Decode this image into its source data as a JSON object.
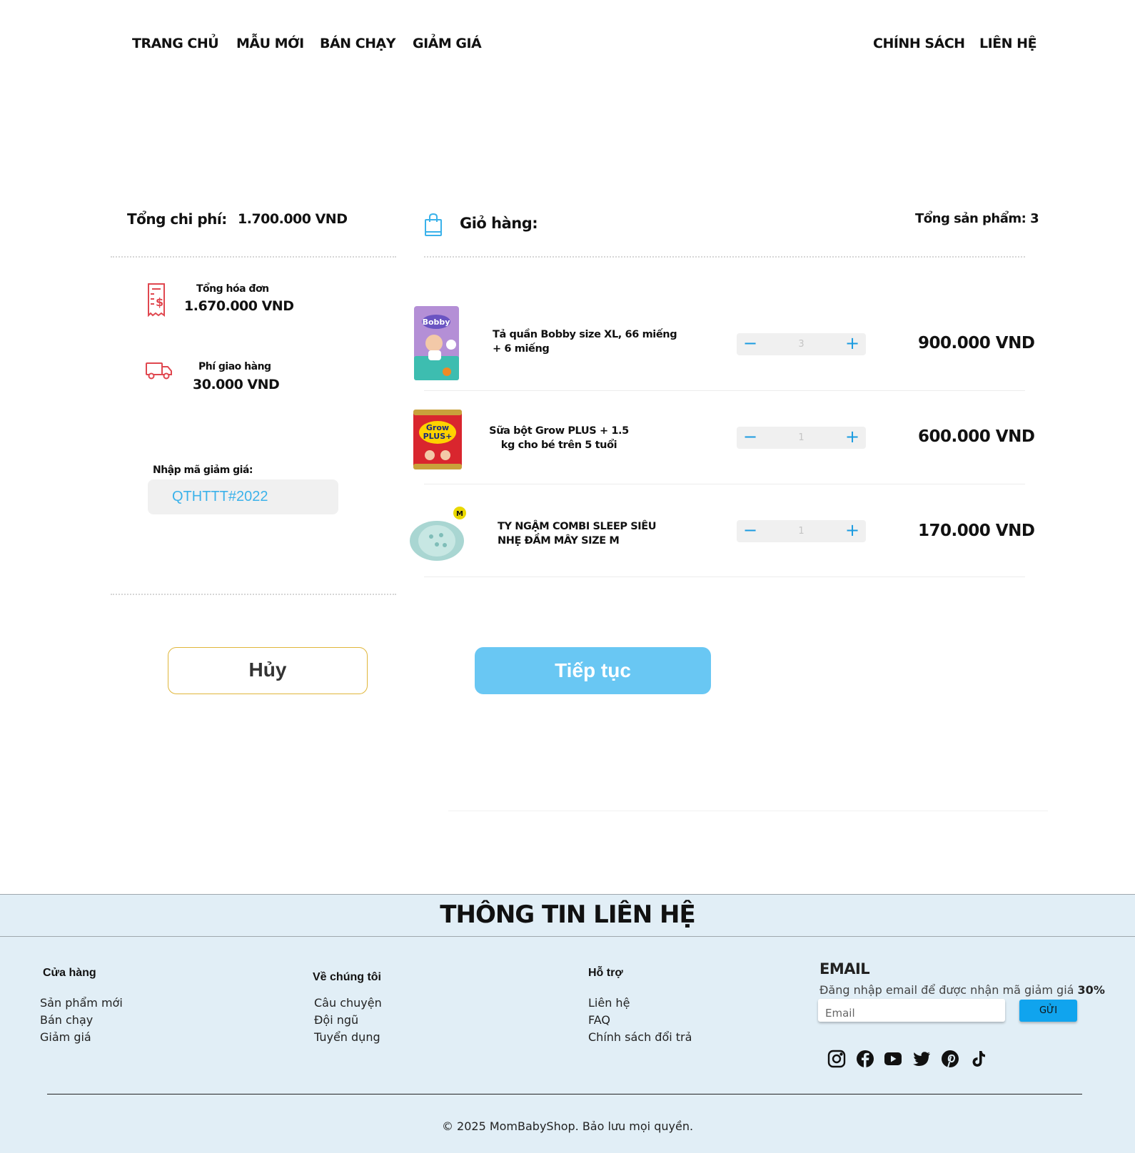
{
  "nav": {
    "left": [
      "TRANG CHỦ",
      "MẪU MỚI",
      "BÁN CHẠY",
      "GIẢM GIÁ"
    ],
    "right": [
      "CHÍNH SÁCH",
      "LIÊN HỆ"
    ]
  },
  "summary": {
    "title": "Tổng chi phí:",
    "total": "1.700.000 VND",
    "invoice_label": "Tổng hóa đơn",
    "invoice_value": "1.670.000 VND",
    "shipping_label": "Phí giao hàng",
    "shipping_value": "30.000 VND",
    "coupon_label": "Nhập mã giảm giá:",
    "coupon_value": "QTHTTT#2022"
  },
  "cart": {
    "title": "Giỏ hàng:",
    "count_label": "Tổng sản phẩm: 3",
    "items": [
      {
        "name": "Tả quần  Bobby size XL,  66 miếng + 6 miếng",
        "qty": "3",
        "price": "900.000 VND",
        "image": "diaper-pack"
      },
      {
        "name": "Sữa bột Grow PLUS + 1.5 kg cho bé trên 5 tuổi",
        "qty": "1",
        "price": "600.000  VND",
        "image": "milk-can"
      },
      {
        "name": "TY NGẬM COMBI SLEEP SIÊU NHẸ ĐẦM MÂY SIZE M",
        "qty": "1",
        "price": "170.000 VND",
        "image": "pacifier"
      }
    ],
    "minus": "−",
    "plus": "+"
  },
  "actions": {
    "cancel": "Hủy",
    "continue": "Tiếp tục"
  },
  "footer": {
    "title": "THÔNG TIN LIÊN HỆ",
    "store": {
      "heading": "Cửa hàng",
      "links": [
        "Sản phẩm mới",
        "Bán chạy",
        "Giảm giá"
      ]
    },
    "about": {
      "heading": "Về chúng tôi",
      "links": [
        "Câu chuyện",
        "Đội ngũ",
        "Tuyển dụng"
      ]
    },
    "support": {
      "heading": "Hỗ trợ",
      "links": [
        "Liên hệ",
        "FAQ",
        "Chính sách đổi trả"
      ]
    },
    "email": {
      "title": "EMAIL",
      "desc": "Đăng nhập email để được nhận mã giảm giá ",
      "desc_bold": "30%",
      "placeholder": "Email",
      "send": "GỬI"
    },
    "social": [
      "instagram-icon",
      "facebook-icon",
      "youtube-icon",
      "twitter-icon",
      "pinterest-icon",
      "tiktok-icon"
    ],
    "copyright": "© 2025 MomBabyShop. Bảo lưu mọi quyền."
  },
  "colors": {
    "accent": "#1a9be0",
    "continue_button": "#69c7f3",
    "cancel_border": "#e0b63a",
    "icon_red": "#e0474f",
    "footer_bg": "#e1eef6",
    "send_button": "#10a4ee"
  }
}
